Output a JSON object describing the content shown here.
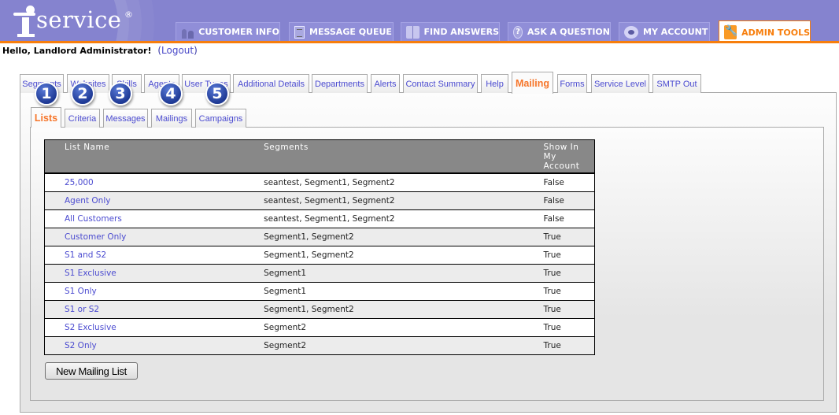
{
  "app": {
    "logo_text": "service",
    "logo_registered": "®"
  },
  "nav": {
    "tabs": [
      {
        "label": "CUSTOMER INFO",
        "icon": "people-icon"
      },
      {
        "label": "MESSAGE QUEUE",
        "icon": "documents-icon"
      },
      {
        "label": "FIND ANSWERS",
        "icon": "book-icon"
      },
      {
        "label": "ASK A QUESTION",
        "icon": "question-icon"
      },
      {
        "label": "MY ACCOUNT",
        "icon": "eye-icon"
      },
      {
        "label": "ADMIN TOOLS",
        "icon": "wrench-icon",
        "active": true
      }
    ]
  },
  "greeting": {
    "text": "Hello, Landlord Administrator!",
    "logout_open": "(",
    "logout_label": "Logout",
    "logout_close": ")"
  },
  "admin_tabs": [
    {
      "label": "Segments"
    },
    {
      "label": "Websites"
    },
    {
      "label": "Skills"
    },
    {
      "label": "Agents"
    },
    {
      "label": "User Types"
    },
    {
      "label": "Additional Details"
    },
    {
      "label": "Departments"
    },
    {
      "label": "Alerts"
    },
    {
      "label": "Contact Summary"
    },
    {
      "label": "Help"
    },
    {
      "label": "Mailing",
      "active": true
    },
    {
      "label": "Forms"
    },
    {
      "label": "Service Level"
    },
    {
      "label": "SMTP Out"
    }
  ],
  "sub_tabs": [
    {
      "label": "Lists",
      "active": true
    },
    {
      "label": "Criteria"
    },
    {
      "label": "Messages"
    },
    {
      "label": "Mailings"
    },
    {
      "label": "Campaigns"
    }
  ],
  "callouts": [
    "1",
    "2",
    "3",
    "4",
    "5"
  ],
  "table": {
    "headers": {
      "name": "List Name",
      "segments": "Segments",
      "show_line1": "Show In",
      "show_line2": "My",
      "show_line3": "Account"
    },
    "rows": [
      {
        "name": "25,000",
        "segments": "seantest, Segment1, Segment2",
        "show": "False"
      },
      {
        "name": "Agent Only",
        "segments": "seantest, Segment1, Segment2",
        "show": "False"
      },
      {
        "name": "All Customers",
        "segments": "seantest, Segment1, Segment2",
        "show": "False"
      },
      {
        "name": "Customer Only",
        "segments": "Segment1, Segment2",
        "show": "True"
      },
      {
        "name": "S1 and S2",
        "segments": "Segment1, Segment2",
        "show": "True"
      },
      {
        "name": "S1 Exclusive",
        "segments": "Segment1",
        "show": "True"
      },
      {
        "name": "S1 Only",
        "segments": "Segment1",
        "show": "True"
      },
      {
        "name": "S1 or S2",
        "segments": "Segment1, Segment2",
        "show": "True"
      },
      {
        "name": "S2 Exclusive",
        "segments": "Segment2",
        "show": "True"
      },
      {
        "name": "S2 Only",
        "segments": "Segment2",
        "show": "True"
      }
    ]
  },
  "buttons": {
    "new_list": "New Mailing List"
  },
  "colors": {
    "header_bg": "#8583cf",
    "accent_orange": "#f77e0c",
    "link_blue": "#4b4bd0",
    "table_header_bg": "#888888"
  }
}
